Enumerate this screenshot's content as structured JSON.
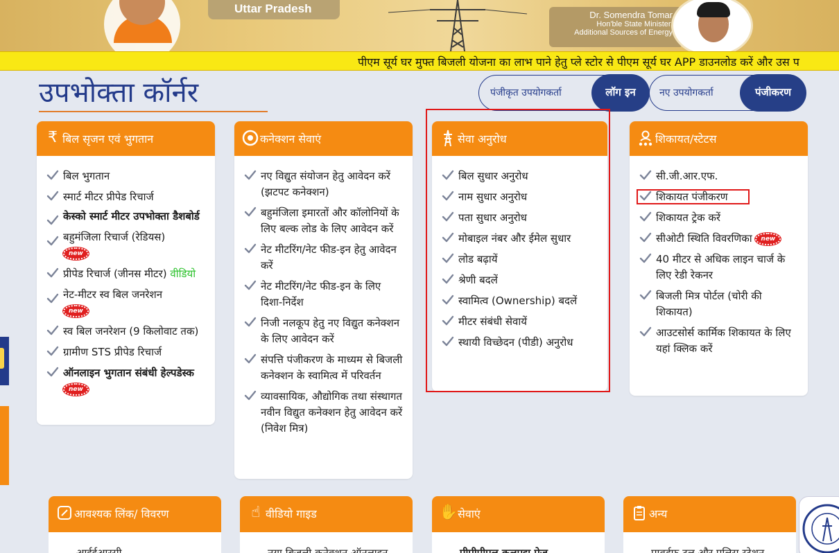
{
  "banner": {
    "state_label": "Uttar Pradesh",
    "minister_name": "Dr. Somendra Tomar",
    "minister_title_1": "Hon'ble State Minister,",
    "minister_title_2": "Additional Sources of Energy"
  },
  "ticker": {
    "text": "पीएम सूर्य घर मुफ्त बिजली योजना का लाभ पाने हेतु प्ले स्टोर से पीएम सूर्य घर APP डाउनलोड करें और उस प"
  },
  "page_title": "उपभोक्ता कॉर्नर",
  "auth": {
    "registered_label": "पंजीकृत उपयोगकर्ता",
    "login_button": "लॉग इन",
    "new_user_label": "नए उपयोगकर्ता",
    "register_button": "पंजीकरण"
  },
  "badge_new": "new",
  "cards": {
    "billing": {
      "title": "बिल सृजन एवं भुगतान",
      "icon": "rupee-icon",
      "items": [
        "बिल भुगतान",
        "स्मार्ट मीटर प्रीपेड रिचार्ज",
        "केस्को स्मार्ट मीटर उपभोक्ता डैशबोर्ड",
        "बहुमंजिला रिचार्ज (रेडियस)",
        "प्रीपेड रिचार्ज (जीनस मीटर)",
        "नेट-मीटर स्व बिल जनरेशन",
        "स्व बिल जनरेशन (9 किलोवाट तक)",
        "ग्रामीण STS प्रीपेड रिचार्ज",
        "ऑनलाइन भुगतान संबंधी हेल्पडेस्क"
      ],
      "video_link": "वीडियो"
    },
    "connection": {
      "title": "कनेक्शन सेवाएं",
      "icon": "plug-icon",
      "items": [
        "नए विद्युत संयोजन  हेतु आवेदन करें (झटपट कनेक्शन)",
        "बहुमंजिला इमारतों और कॉलोनियों के लिए बल्क लोड के लिए आवेदन करें",
        "नेट मीटरिंग/नेट फीड-इन हेतु आवेदन करें",
        "नेट मीटरिंग/नेट फीड-इन के लिए दिशा-निर्देश",
        "निजी नलकूप हेतु नए विद्युत कनेक्शन के लिए आवेदन करें",
        "संपत्ति पंजीकरण के माध्यम से बिजली कनेक्शन के स्वामित्व में परिवर्तन",
        "व्यावसायिक, औद्योगिक तथा संस्थागत नवीन विद्युत कनेक्शन हेतु आवेदन करें (निवेश मित्र)"
      ]
    },
    "service": {
      "title": "सेवा अनुरोध",
      "icon": "tower-icon",
      "items": [
        "बिल सुधार अनुरोध",
        "नाम सुधार अनुरोध",
        "पता सुधार अनुरोध",
        "मोबाइल नंबर और ईमेल  सुधार",
        "लोड बढ़ायें",
        "श्रेणी बदलें",
        "स्वामित्व (Ownership) बदलें",
        "मीटर संबंधी सेवायें",
        "स्थायी विच्छेदन (पीडी) अनुरोध"
      ]
    },
    "complaint": {
      "title": "शिकायत/स्टेटस",
      "icon": "user-stars-icon",
      "items": [
        "सी.जी.आर.एफ.",
        "शिकायत पंजीकरण",
        "शिकायत ट्रेक करें",
        "सीओटी स्थिति विवरणिका",
        "40 मीटर से अधिक लाइन चार्ज के लिए रेडी रेकनर",
        "बिजली मित्र पोर्टल (चोरी की शिकायत)",
        "आउटसोर्स कार्मिक शिकायत के लिए यहां क्लिक करें"
      ]
    }
  },
  "bottom_cards": [
    {
      "title": "आवश्यक लिंक/ विवरण",
      "icon": "link-icon",
      "peek": "आईईआरसी"
    },
    {
      "title": "वीडियो गाइड",
      "icon": "hand-pointer-icon",
      "peek": "नया बिजली कनेक्शन ऑनलाइन"
    },
    {
      "title": "सेवाएं",
      "icon": "hand-service-icon",
      "peek": "पीपीपीएल कलपद्म पेज"
    },
    {
      "title": "अन्य",
      "icon": "clipboard-icon",
      "peek": "पावर्डफ़ टुल और पुलिस स्टेशन"
    }
  ],
  "colors": {
    "accent": "#f58b12",
    "navy": "#233a8a",
    "ticker": "#f9e814",
    "highlight": "#e01818"
  }
}
